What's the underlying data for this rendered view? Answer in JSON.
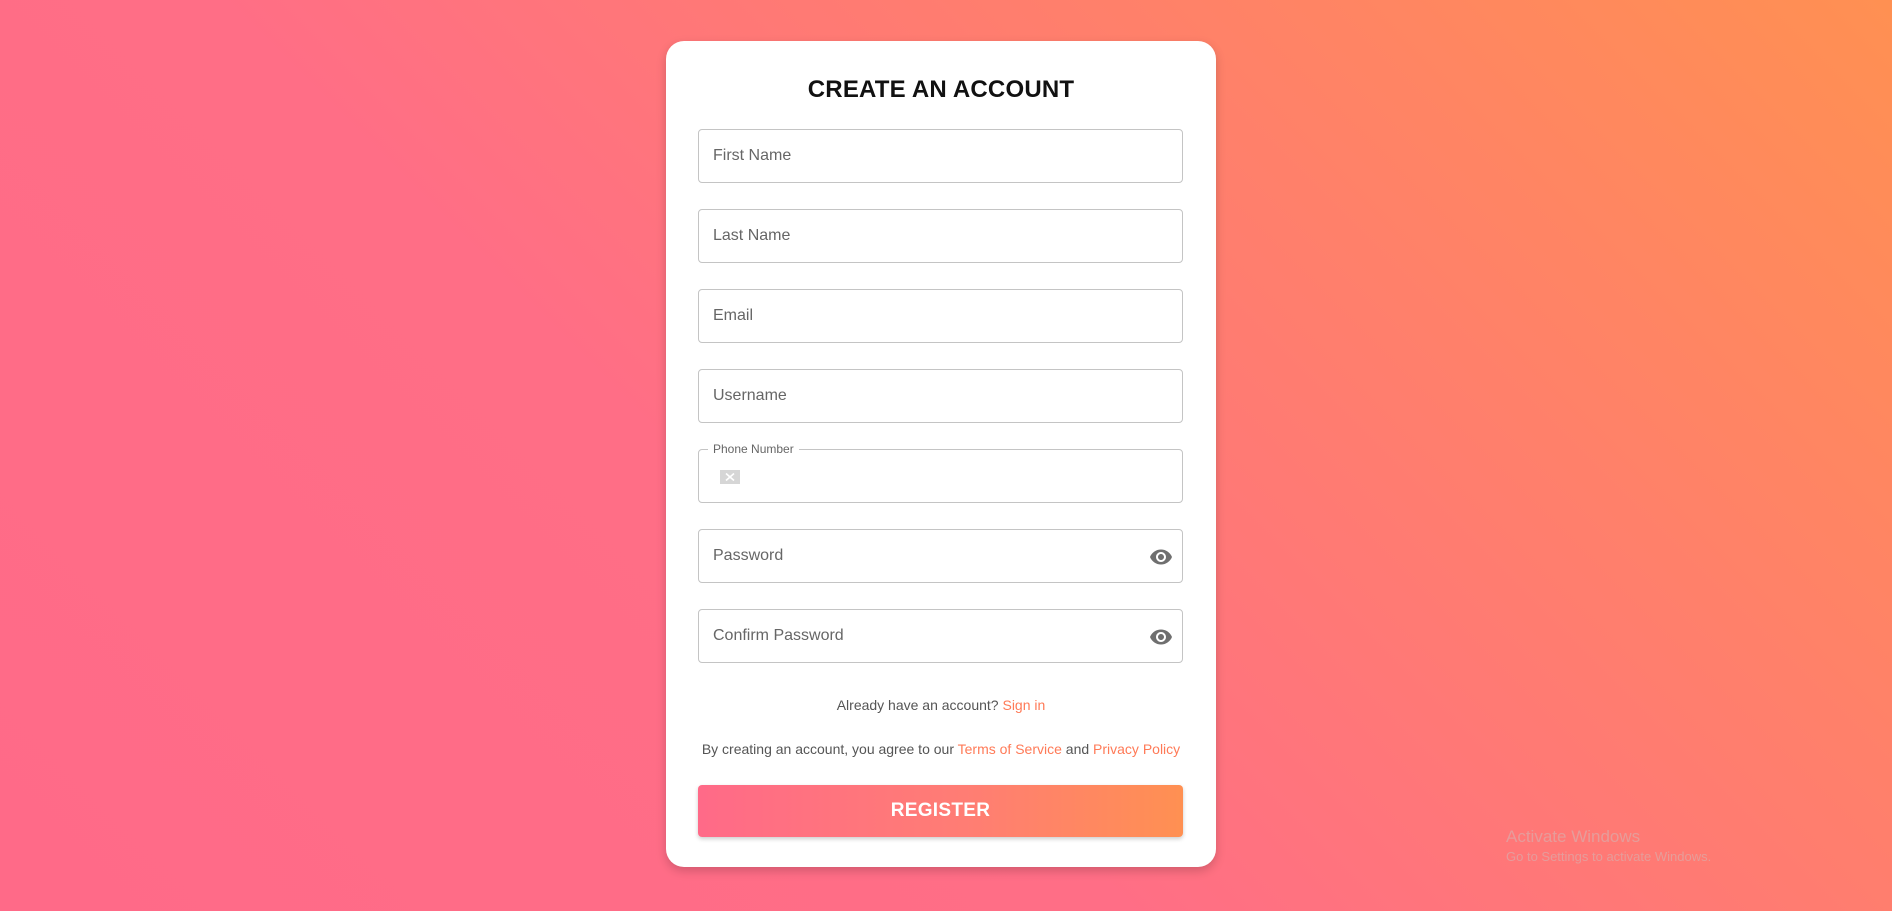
{
  "form": {
    "title": "CREATE AN ACCOUNT",
    "first_name": {
      "placeholder": "First Name",
      "value": ""
    },
    "last_name": {
      "placeholder": "Last Name",
      "value": ""
    },
    "email": {
      "placeholder": "Email",
      "value": ""
    },
    "username": {
      "placeholder": "Username",
      "value": ""
    },
    "phone": {
      "label": "Phone Number",
      "value": ""
    },
    "password": {
      "placeholder": "Password",
      "value": ""
    },
    "confirm_password": {
      "placeholder": "Confirm Password",
      "value": ""
    },
    "signin_prompt": "Already have an account?",
    "signin_link": "Sign in",
    "terms_prefix": "By creating an account, you agree to our",
    "terms_link": "Terms of Service",
    "terms_and": "and",
    "privacy_link": "Privacy Policy",
    "register_label": "REGISTER"
  },
  "icons": {
    "visibility": "eye-icon",
    "flag": "flag-placeholder-icon"
  },
  "colors": {
    "gradient_start": "#ff6a88",
    "gradient_end": "#ff9052",
    "link": "#ff7a57"
  },
  "watermark": {
    "title": "Activate Windows",
    "subtitle": "Go to Settings to activate Windows."
  }
}
